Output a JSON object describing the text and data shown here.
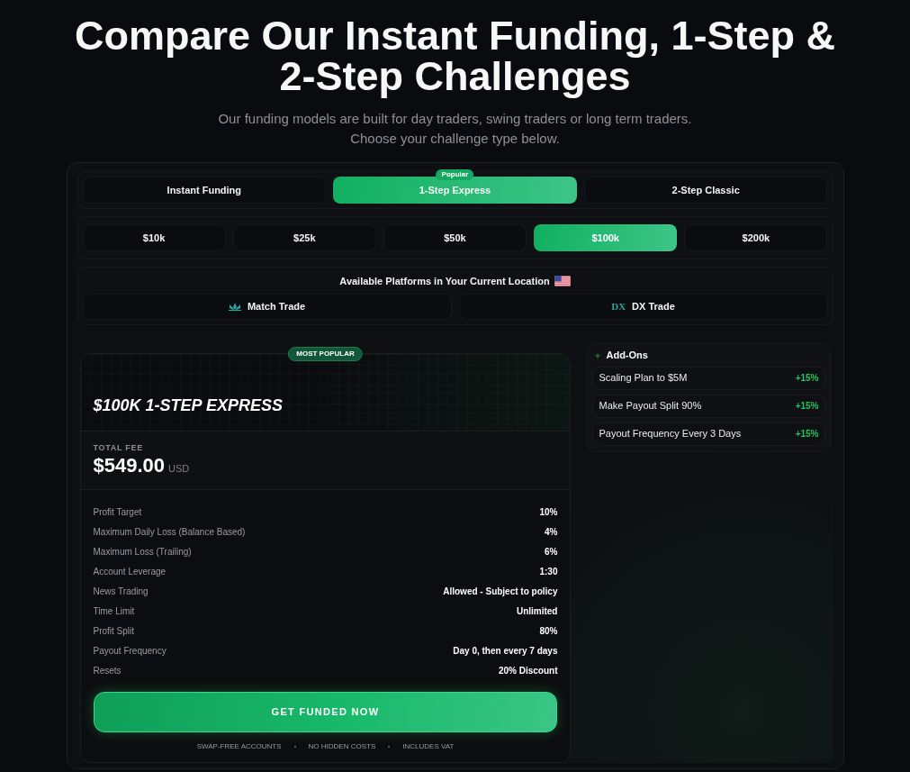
{
  "header": {
    "title": "Compare Our Instant Funding, 1-Step & 2-Step Challenges",
    "subtitle_lines": [
      "Our funding models are built for day traders, swing traders or long term traders.",
      "Choose your challenge type below."
    ]
  },
  "challenge_tabs": [
    {
      "label": "Instant Funding",
      "selected": false
    },
    {
      "label": "1-Step Express",
      "selected": true,
      "badge": "Popular"
    },
    {
      "label": "2-Step Classic",
      "selected": false
    }
  ],
  "account_sizes": [
    {
      "label": "$10k",
      "selected": false
    },
    {
      "label": "$25k",
      "selected": false
    },
    {
      "label": "$50k",
      "selected": false
    },
    {
      "label": "$100k",
      "selected": true
    },
    {
      "label": "$200k",
      "selected": false
    }
  ],
  "platforms": {
    "heading": "Available Platforms in Your Current Location",
    "items": [
      {
        "kind": "lotus",
        "label": "Match Trade",
        "selected": false
      },
      {
        "kind": "text_logo",
        "logo": "DX",
        "label": "DX Trade",
        "selected": false
      }
    ]
  },
  "plan_card": {
    "badge": "MOST POPULAR",
    "title": "$100K 1-STEP EXPRESS",
    "fee_label": "TOTAL FEE",
    "fee": "$549.00",
    "currency": "USD",
    "rows": [
      {
        "label": "Profit Target",
        "value": "10%"
      },
      {
        "label": "Maximum Daily Loss (Balance Based)",
        "value": "4%"
      },
      {
        "label": "Maximum Loss (Trailing)",
        "value": "6%"
      },
      {
        "label": "Account Leverage",
        "value": "1:30"
      },
      {
        "label": "News Trading",
        "value": "Allowed - Subject to policy"
      },
      {
        "label": "Time Limit",
        "value": "Unlimited"
      },
      {
        "label": "Profit Split",
        "value": "80%"
      },
      {
        "label": "Payout Frequency",
        "value": "Day 0, then every 7 days"
      },
      {
        "label": "Resets",
        "value": "20% Discount"
      }
    ],
    "cta": "GET FUNDED NOW",
    "features": [
      "SWAP-FREE ACCOUNTS",
      "NO HIDDEN COSTS",
      "INCLUDES VAT"
    ]
  },
  "add_ons": {
    "title": "Add-Ons",
    "items": [
      {
        "label": "Scaling Plan to $5M",
        "price": "+15%"
      },
      {
        "label": "Make Payout Split 90%",
        "price": "+15%"
      },
      {
        "label": "Payout Frequency Every 3 Days",
        "price": "+15%"
      }
    ]
  }
}
